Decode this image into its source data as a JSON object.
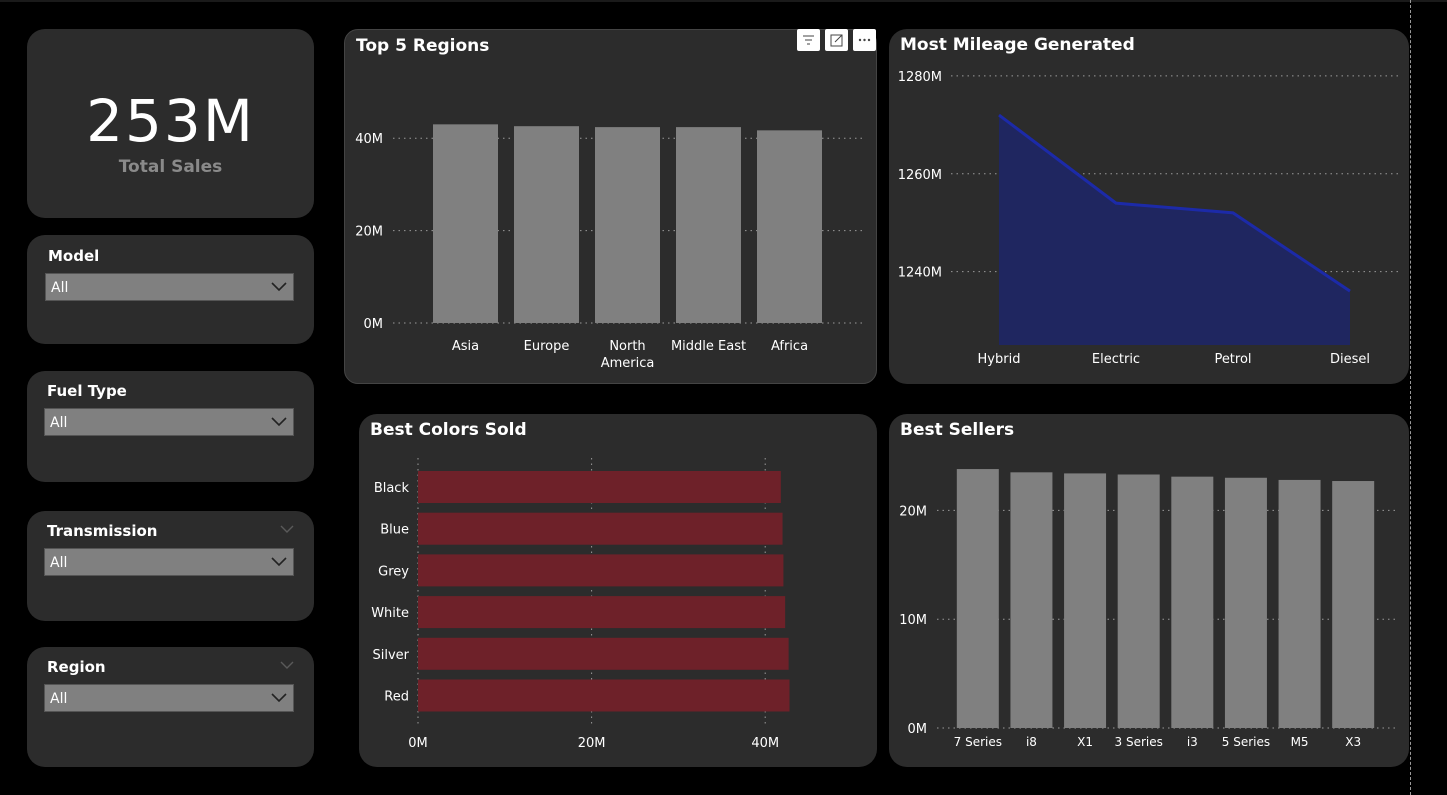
{
  "kpi": {
    "value": "253M",
    "label": "Total Sales"
  },
  "slicers": [
    {
      "title": "Model",
      "value": "All"
    },
    {
      "title": "Fuel Type",
      "value": "All"
    },
    {
      "title": "Transmission",
      "value": "All"
    },
    {
      "title": "Region",
      "value": "All"
    }
  ],
  "colors": {
    "bar_gray": "#808080",
    "bar_red": "#6e2129",
    "area_fill": "#1f2660",
    "area_line": "#1c2aa8",
    "card_bg": "#2c2c2c"
  },
  "icons": [
    "filter-icon",
    "focus-mode-icon",
    "more-options-icon",
    "chevron-down-icon"
  ],
  "chart_data": [
    {
      "type": "bar",
      "title": "Top 5 Regions",
      "categories": [
        "Asia",
        "Europe",
        "North America",
        "Middle East",
        "Africa"
      ],
      "values": [
        43,
        42.6,
        42.4,
        42.4,
        41.7
      ],
      "yticks": [
        "0M",
        "20M",
        "40M"
      ],
      "ylim": [
        0,
        50
      ],
      "grid": true
    },
    {
      "type": "area",
      "title": "Most Mileage Generated",
      "categories": [
        "Hybrid",
        "Electric",
        "Petrol",
        "Diesel"
      ],
      "values": [
        1272,
        1254,
        1252,
        1236
      ],
      "yticks": [
        "1240M",
        "1260M",
        "1280M"
      ],
      "ylim": [
        1225,
        1281
      ],
      "grid": true
    },
    {
      "type": "bar",
      "orientation": "horizontal",
      "title": "Best Colors Sold",
      "categories": [
        "Black",
        "Blue",
        "Grey",
        "White",
        "Silver",
        "Red"
      ],
      "values": [
        41.8,
        42.0,
        42.1,
        42.3,
        42.7,
        42.8
      ],
      "xticks": [
        "0M",
        "20M",
        "40M"
      ],
      "xlim": [
        0,
        50
      ],
      "grid": true
    },
    {
      "type": "bar",
      "title": "Best Sellers",
      "categories": [
        "7 Series",
        "i8",
        "X1",
        "3 Series",
        "i3",
        "5 Series",
        "M5",
        "X3"
      ],
      "values": [
        23.8,
        23.5,
        23.4,
        23.3,
        23.1,
        23.0,
        22.8,
        22.7
      ],
      "yticks": [
        "0M",
        "10M",
        "20M"
      ],
      "ylim": [
        0,
        25
      ],
      "grid": true
    }
  ]
}
